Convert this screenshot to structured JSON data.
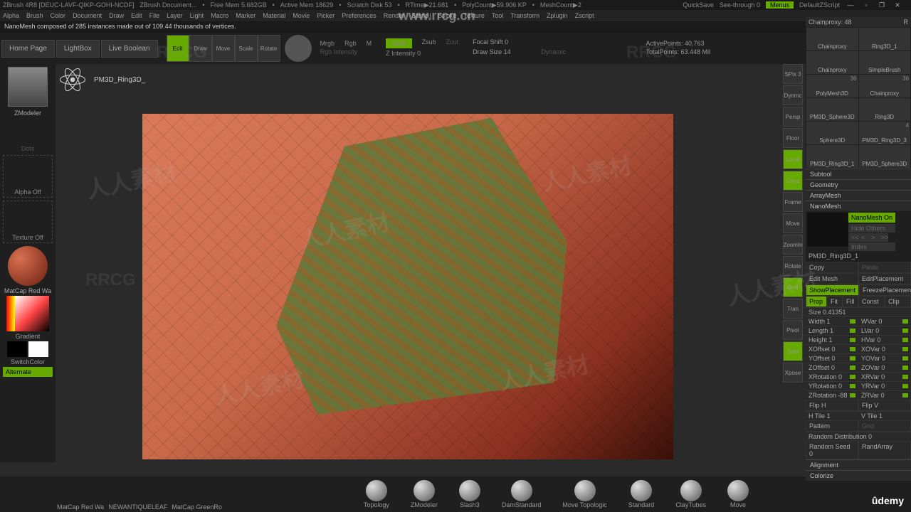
{
  "titlebar": {
    "app": "ZBrush 4R8 [DEUC-LAVF-QIKP-GOHI-NCDF]",
    "doc": "ZBrush Document...",
    "freemem": "Free Mem 5.682GB",
    "activemem": "Active Mem 18629",
    "scratch": "Scratch Disk 53",
    "rtime": "RTime▶21.681",
    "polycount": "PolyCount▶59.906 KP",
    "meshcount": "MeshCount▶2",
    "quicksave": "QuickSave",
    "seethrough": "See-through 0",
    "menus": "Menus",
    "defaultz": "DefaultZScript"
  },
  "menubar": [
    "Alpha",
    "Brush",
    "Color",
    "Document",
    "Draw",
    "Edit",
    "File",
    "Layer",
    "Light",
    "Macro",
    "Marker",
    "Material",
    "Movie",
    "Picker",
    "Preferences",
    "Render",
    "Stencil",
    "Stroke",
    "Texture",
    "Tool",
    "Transform",
    "Zplugin",
    "Zscript"
  ],
  "info": "NanoMesh composed of 285 instances made out of 109.44 thousands of vertices.",
  "toolbar": {
    "home": "Home Page",
    "lightbox": "LightBox",
    "boolean": "Live Boolean",
    "modes": [
      "Edit",
      "Draw",
      "Move",
      "Scale",
      "Rotate"
    ],
    "rgb": {
      "mrgb": "Mrgb",
      "rgb": "Rgb",
      "m": "M",
      "intensity": "Rgb Intensity"
    },
    "z": {
      "zadd": "Zadd",
      "zsub": "Zsub",
      "zcut": "Zcut",
      "zint": "Z Intensity 0"
    },
    "focal": "Focal Shift 0",
    "drawsize": "Draw Size 14",
    "dynamic": "Dynamic",
    "active": "ActivePoints: 40,763",
    "total": "TotalPoints: 63.448 Mil"
  },
  "left": {
    "zmodeler": "ZModeler",
    "toolname": "PM3D_Ring3D_",
    "dots": "Dots",
    "alpha": "Alpha Off",
    "texture": "Texture Off",
    "material": "MatCap Red Wa",
    "gradient": "Gradient",
    "switch": "SwitchColor",
    "alternate": "Alternate"
  },
  "right_toolbar": [
    "SPix 3",
    "Dynmc",
    "Persp",
    "Floor",
    "Local",
    "Gxyz",
    "Frame",
    "Move",
    "ZoomIn",
    "Rotate",
    "Grid",
    "Tran",
    "Pivot",
    "Solo",
    "Xpose"
  ],
  "rp": {
    "header": "Chainproxy: 48",
    "r": "R",
    "tools": [
      {
        "n": "Chainproxy",
        "b": ""
      },
      {
        "n": "Ring3D_1",
        "b": ""
      },
      {
        "n": "Chainproxy",
        "b": ""
      },
      {
        "n": "SimpleBrush",
        "b": ""
      },
      {
        "n": "PolyMesh3D",
        "b": "36"
      },
      {
        "n": "Chainproxy",
        "b": "36"
      },
      {
        "n": "PM3D_Sphere3D",
        "b": ""
      },
      {
        "n": "Ring3D",
        "b": ""
      },
      {
        "n": "Sphere3D",
        "b": ""
      },
      {
        "n": "PM3D_Ring3D_3",
        "b": "4"
      },
      {
        "n": "PM3D_Ring3D_1",
        "b": ""
      },
      {
        "n": "PM3D_Sphere3D",
        "b": ""
      }
    ],
    "sections": [
      "Subtool",
      "Geometry",
      "ArrayMesh",
      "NanoMesh"
    ],
    "nano": {
      "on": "NanoMesh On",
      "hide": "Hide Others",
      "arrows": [
        "<<",
        "<",
        ">",
        ">>"
      ],
      "index": "Index",
      "name": "PM3D_Ring3D_1",
      "copy": "Copy",
      "paste": "Paste",
      "edit": "Edit Mesh",
      "editplace": "EditPlacement",
      "showplace": "ShowPlacement",
      "freeze": "FreezePlacemen",
      "prop": "Prop",
      "fit": "Fit",
      "fill": "Fill",
      "const": "Const",
      "clip": "Clip",
      "size": "Size 0.41351",
      "sliders": [
        [
          "Width 1",
          "WVar 0"
        ],
        [
          "Length 1",
          "LVar 0"
        ],
        [
          "Height 1",
          "HVar 0"
        ],
        [
          "XOffset 0",
          "XOVar 0"
        ],
        [
          "YOffset 0",
          "YOVar 0"
        ],
        [
          "ZOffset 0",
          "ZOVar 0"
        ],
        [
          "XRotation 0",
          "XRVar 0"
        ],
        [
          "YRotation 0",
          "YRVar 0"
        ],
        [
          "ZRotation -88",
          "ZRVar 0"
        ]
      ],
      "flip": [
        "Flip H",
        "Flip V"
      ],
      "tile": [
        "H Tile 1",
        "V Tile 1"
      ],
      "pattern": "Pattern",
      "grid": "Grid",
      "randdist": "Random Distribution 0",
      "randseed": "Random Seed 0",
      "randarray": "RandArray",
      "align": "Alignment",
      "colorize": "Colorize"
    }
  },
  "bottom": {
    "mats": [
      "MatCap Red Wa",
      "NEWANTIQUELEAF",
      "MatCap GreenRo"
    ],
    "brushes": [
      "Topology",
      "ZModeler",
      "Slash3",
      "DamStandard",
      "Move Topologic",
      "Standard",
      "ClayTubes",
      "Move"
    ]
  },
  "wm_url": "www.rrcg.cn",
  "wm_text": "人人素材",
  "udemy": "ûdemy"
}
